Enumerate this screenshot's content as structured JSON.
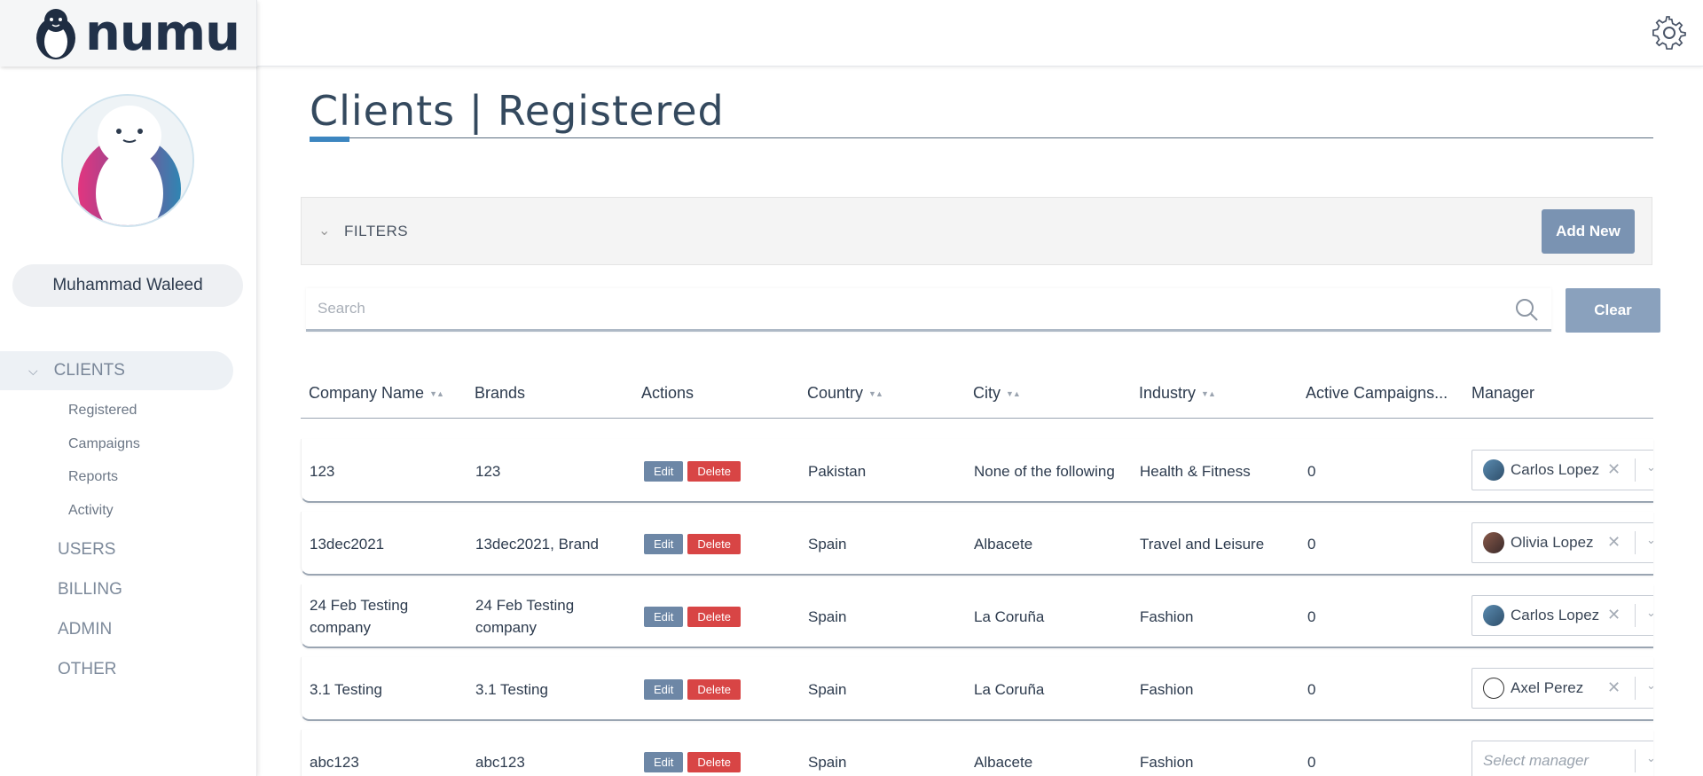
{
  "app": {
    "logo_text": "numu"
  },
  "sidebar": {
    "user_name": "Muhammad Waleed",
    "sections": {
      "clients": "CLIENTS",
      "users": "USERS",
      "billing": "BILLING",
      "admin": "ADMIN",
      "other": "OTHER"
    },
    "client_items": [
      "Registered",
      "Campaigns",
      "Reports",
      "Activity"
    ]
  },
  "page": {
    "title": "Clients | Registered"
  },
  "filters": {
    "label": "FILTERS",
    "add_new": "Add New"
  },
  "search": {
    "placeholder": "Search",
    "clear": "Clear"
  },
  "table": {
    "headers": [
      "Company Name",
      "Brands",
      "Actions",
      "Country",
      "City",
      "Industry",
      "Active Campaigns...",
      "Manager"
    ],
    "edit_label": "Edit",
    "delete_label": "Delete",
    "manager_placeholder": "Select manager",
    "rows": [
      {
        "company": "123",
        "brands": "123",
        "country": "Pakistan",
        "city": "None of the following",
        "industry": "Health & Fitness",
        "active": "0",
        "manager": "Carlos Lopez"
      },
      {
        "company": "13dec2021",
        "brands": "13dec2021, Brand",
        "country": "Spain",
        "city": "Albacete",
        "industry": "Travel and Leisure",
        "active": "0",
        "manager": "Olivia Lopez"
      },
      {
        "company": "24 Feb Testing company",
        "brands": "24 Feb Testing company",
        "country": "Spain",
        "city": "La Coruña",
        "industry": "Fashion",
        "active": "0",
        "manager": "Carlos Lopez"
      },
      {
        "company": "3.1 Testing",
        "brands": "3.1 Testing",
        "country": "Spain",
        "city": "La Coruña",
        "industry": "Fashion",
        "active": "0",
        "manager": "Axel Perez"
      },
      {
        "company": "abc123",
        "brands": "abc123",
        "country": "Spain",
        "city": "Albacete",
        "industry": "Fashion",
        "active": "0",
        "manager": ""
      }
    ]
  },
  "icons": {
    "settings": "gear-icon",
    "search": "search-icon",
    "collapse": "chevron-down-icon"
  }
}
